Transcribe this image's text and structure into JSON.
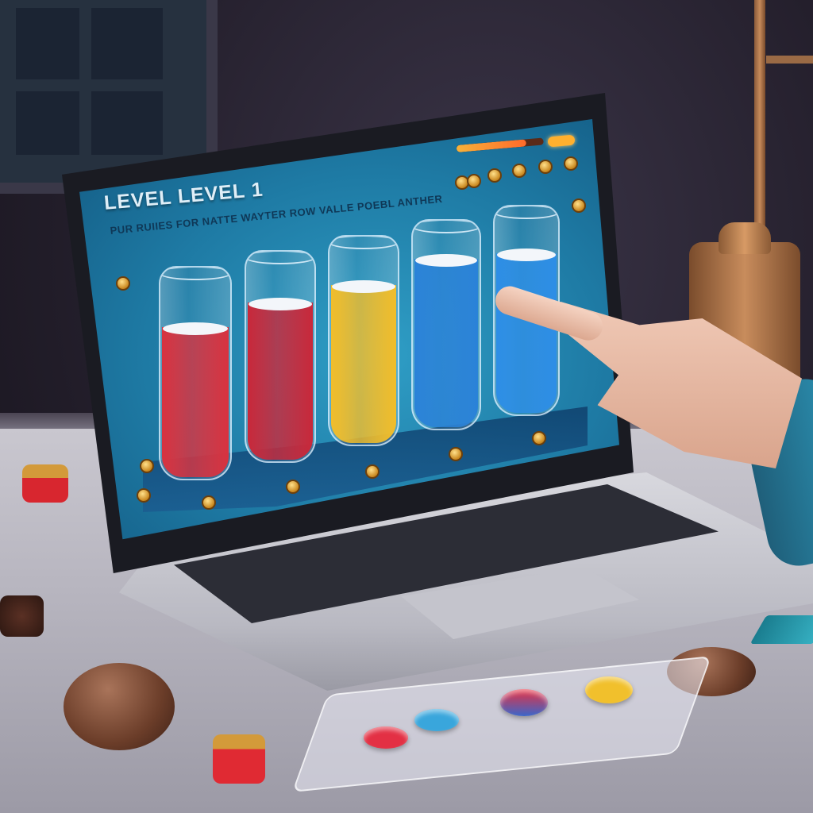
{
  "game": {
    "level_title": "LEVEL LEVEL 1",
    "instruction": "PUR RUIIES FOR NATTE WAYTER ROW VALLE POEBL ANTHER",
    "progress_fraction": 0.8
  },
  "tubes": [
    {
      "color": "#d8323f",
      "fill": 0.72
    },
    {
      "color": "#c8283a",
      "fill": 0.76
    },
    {
      "color": "#f1bd2a",
      "fill": 0.77
    },
    {
      "color": "#2a82d8",
      "fill": 0.82
    },
    {
      "color": "#2d8ee6",
      "fill": 0.78
    }
  ],
  "colors": {
    "screen_accent": "#2f9ec6",
    "progress": "#ff6a2a",
    "coin": "#e0a43a"
  },
  "icons": [
    "coin-icon",
    "progress-bar",
    "pointing-hand"
  ]
}
